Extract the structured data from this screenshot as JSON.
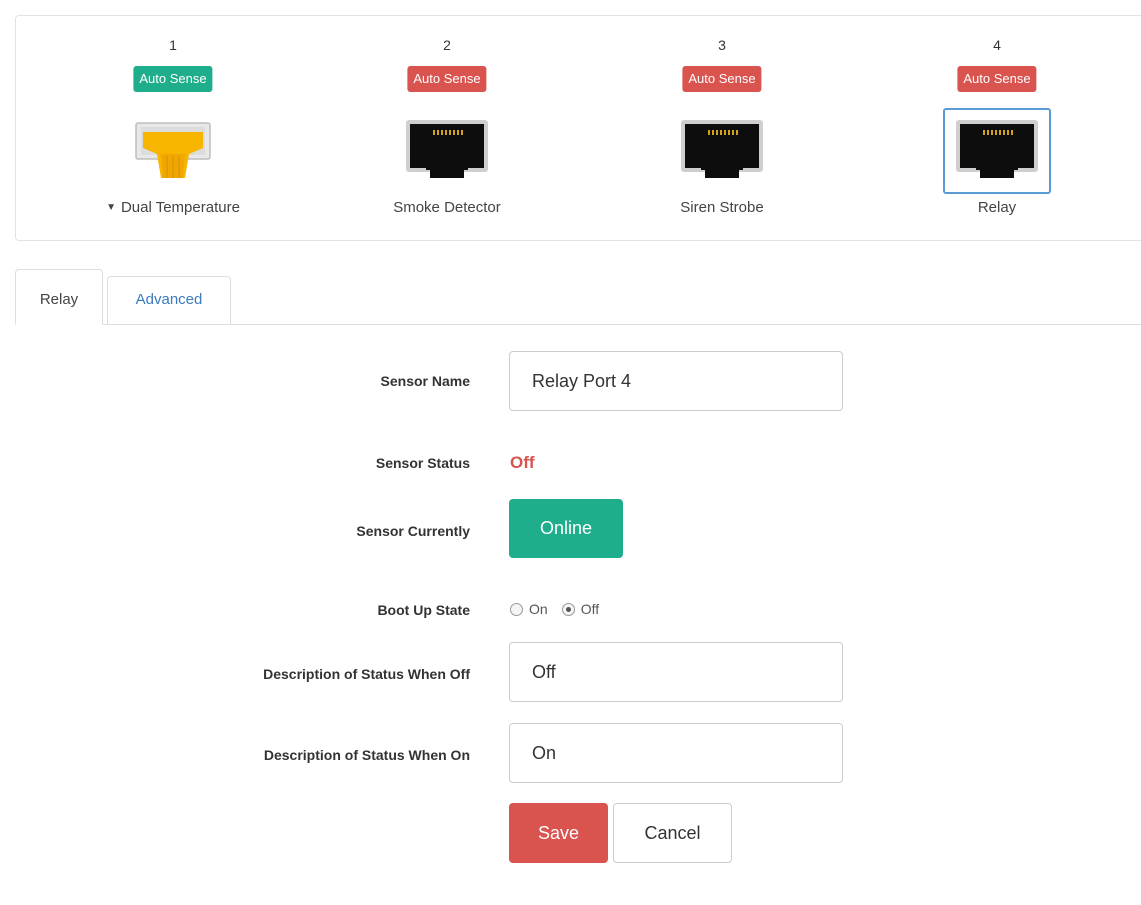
{
  "ports": [
    {
      "number": "1",
      "badge": "Auto Sense",
      "badge_color": "#1fae8b",
      "label": "Dual Temperature",
      "icon": "yellow-sensor-plug-icon",
      "has_caret": true
    },
    {
      "number": "2",
      "badge": "Auto Sense",
      "badge_color": "#d9534f",
      "label": "Smoke Detector",
      "icon": "rj45-port-icon"
    },
    {
      "number": "3",
      "badge": "Auto Sense",
      "badge_color": "#d9534f",
      "label": "Siren Strobe",
      "icon": "rj45-port-icon"
    },
    {
      "number": "4",
      "badge": "Auto Sense",
      "badge_color": "#d9534f",
      "label": "Relay",
      "icon": "rj45-port-icon",
      "selected": true
    }
  ],
  "tabs": [
    {
      "label": "Relay",
      "active": true
    },
    {
      "label": "Advanced",
      "active": false
    }
  ],
  "form": {
    "sensor_name_label": "Sensor Name",
    "sensor_name_value": "Relay Port 4",
    "sensor_status_label": "Sensor Status",
    "sensor_status_value": "Off",
    "sensor_currently_label": "Sensor Currently",
    "sensor_currently_value": "Online",
    "boot_up_label": "Boot Up State",
    "boot_up_options": [
      "On",
      "Off"
    ],
    "boot_up_selected": "Off",
    "desc_off_label": "Description of Status When Off",
    "desc_off_value": "Off",
    "desc_on_label": "Description of Status When On",
    "desc_on_value": "On",
    "save_label": "Save",
    "cancel_label": "Cancel"
  },
  "colors": {
    "accent_green": "#1fae8b",
    "accent_red": "#d9534f",
    "link_blue": "#3a7bbf"
  }
}
